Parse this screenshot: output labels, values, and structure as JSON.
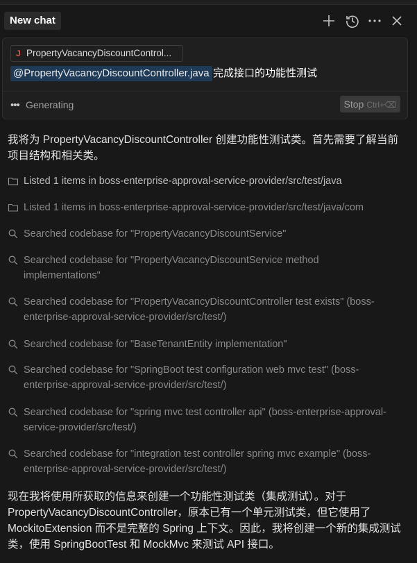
{
  "header": {
    "tab_label": "New chat"
  },
  "composer": {
    "file_chip_label": "PropertyVacancyDiscountControl...",
    "mention": "@PropertyVacancyDiscountController.java",
    "prompt_text": "完成接口的功能性测试",
    "status_text": "Generating",
    "stop_label": "Stop",
    "stop_shortcut": "Ctrl+⌫"
  },
  "messages": {
    "intro": "我将为 PropertyVacancyDiscountController 创建功能性测试类。首先需要了解当前项目结构和相关类。",
    "steps": [
      {
        "icon": "folder-icon",
        "text": "Listed 1 items in boss-enterprise-approval-service-provider/src/test/java"
      },
      {
        "icon": "folder-icon",
        "text": "Listed 1 items in boss-enterprise-approval-service-provider/src/test/java/com"
      },
      {
        "icon": "search-icon",
        "text": "Searched codebase for \"PropertyVacancyDiscountService\""
      },
      {
        "icon": "search-icon",
        "text": "Searched codebase for \"PropertyVacancyDiscountService method implementations\""
      },
      {
        "icon": "search-icon",
        "text": "Searched codebase for \"PropertyVacancyDiscountController test exists\" (boss-enterprise-approval-service-provider/src/test/)"
      },
      {
        "icon": "search-icon",
        "text": "Searched codebase for \"BaseTenantEntity implementation\""
      },
      {
        "icon": "search-icon",
        "text": "Searched codebase for \"SpringBoot test configuration web mvc test\" (boss-enterprise-approval-service-provider/src/test/)"
      },
      {
        "icon": "search-icon",
        "text": "Searched codebase for \"spring mvc test controller api\" (boss-enterprise-approval-service-provider/src/test/)"
      },
      {
        "icon": "search-icon",
        "text": "Searched codebase for \"integration test controller spring mvc example\" (boss-enterprise-approval-service-provider/src/test/)"
      }
    ],
    "outro": "现在我将使用所获取的信息来创建一个功能性测试类（集成测试）。对于 PropertyVacancyDiscountController，原本已有一个单元测试类，但它使用了 MockitoExtension 而不是完整的 Spring 上下文。因此，我将创建一个新的集成测试类，使用 SpringBootTest 和 MockMvc 来测试 API 接口。"
  }
}
